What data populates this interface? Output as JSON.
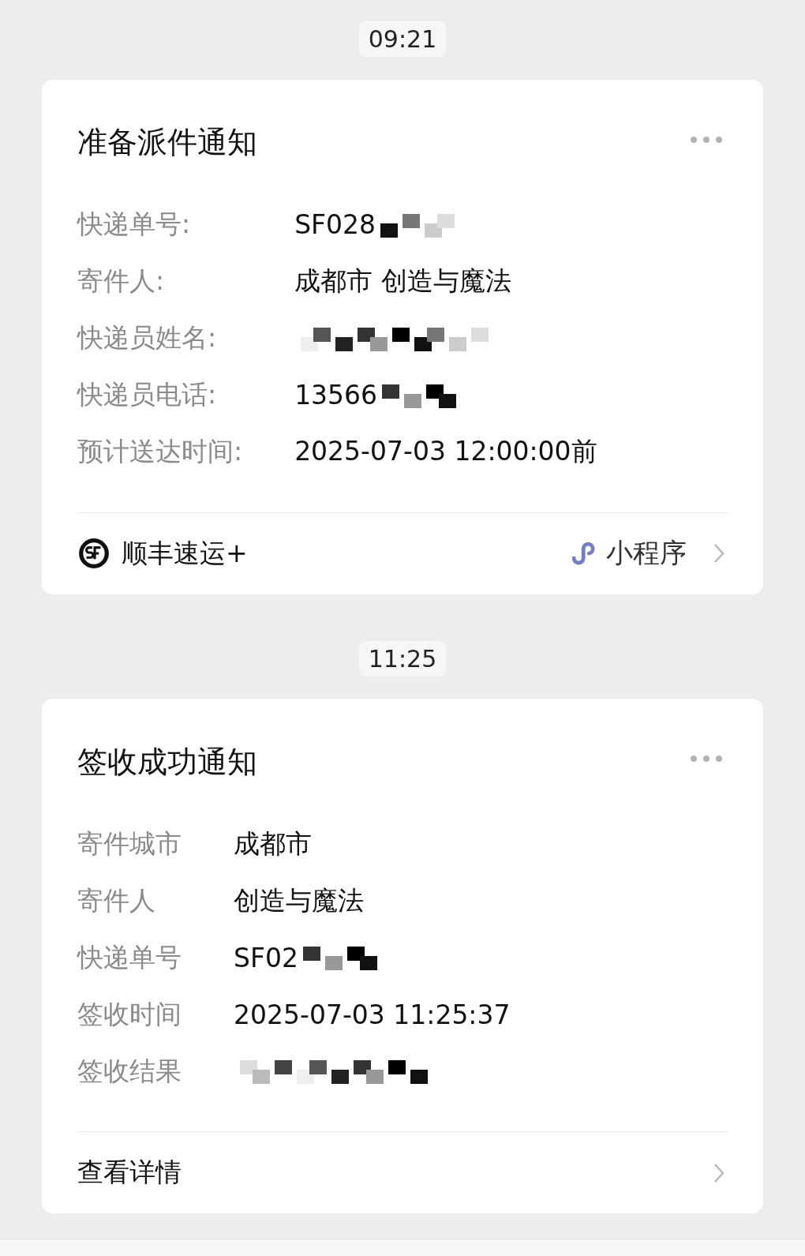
{
  "messages": [
    {
      "time": "09:21",
      "card": {
        "title": "准备派件通知",
        "fields": [
          {
            "label": "快递单号:",
            "value": "SF028",
            "redacted": true
          },
          {
            "label": "寄件人:",
            "value": "成都市 创造与魔法",
            "redacted": false
          },
          {
            "label": "快递员姓名:",
            "redacted": true
          },
          {
            "label": "快递员电话:",
            "value": "13566",
            "redacted": true
          },
          {
            "label": "预计送达时间:",
            "value": "2025-07-03 12:00:00前",
            "redacted": false
          }
        ],
        "footer": {
          "kind": "mini_program",
          "brand": "顺丰速运+",
          "tag": "小程序"
        }
      }
    },
    {
      "time": "11:25",
      "card": {
        "title": "签收成功通知",
        "fields": [
          {
            "label": "寄件城市",
            "value": "成都市",
            "redacted": false
          },
          {
            "label": "寄件人",
            "value": "创造与魔法",
            "redacted": false
          },
          {
            "label": "快递单号",
            "value": "SF02",
            "redacted": true
          },
          {
            "label": "签收时间",
            "value": "2025-07-03 11:25:37",
            "redacted": false
          },
          {
            "label": "签收结果",
            "redacted": true
          }
        ],
        "footer": {
          "kind": "link",
          "label": "查看详情"
        }
      }
    }
  ]
}
